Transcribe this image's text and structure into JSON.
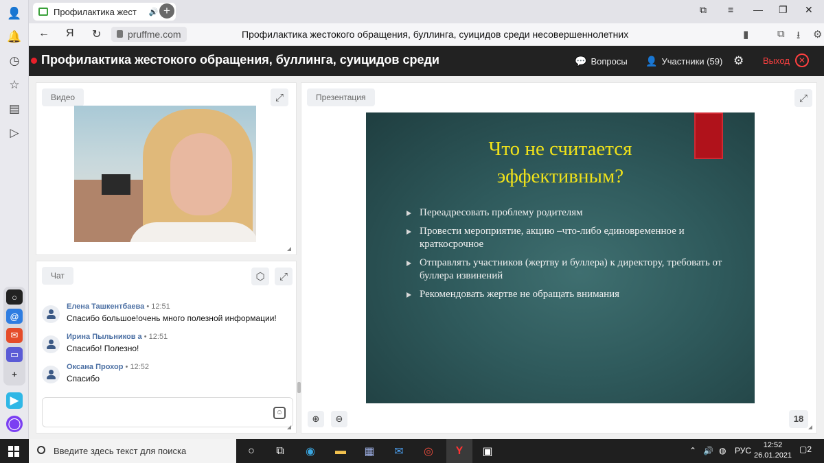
{
  "browser": {
    "tab_title": "Профилактика жест",
    "url": "pruffme.com",
    "page_title": "Профилактика жестокого обращения, буллинга, суицидов среди несовершеннолетних"
  },
  "webinar": {
    "title": "Профилактика жестокого обращения, буллинга, суицидов среди",
    "questions_label": "Вопросы",
    "participants_label": "Участники (59)",
    "exit_label": "Выход"
  },
  "video_panel": {
    "label": "Видео"
  },
  "chat": {
    "label": "Чат",
    "messages": [
      {
        "name": "Елена Ташкентбаева",
        "time": "• 12:51",
        "text": "Спасибо большое!очень много полезной информации!"
      },
      {
        "name": "Ирина Пыльников а",
        "time": "• 12:51",
        "text": "Спасибо! Полезно!"
      },
      {
        "name": "Оксана Прохор",
        "time": "• 12:52",
        "text": "Спасибо"
      }
    ],
    "input_value": ""
  },
  "presentation": {
    "label": "Презентация",
    "slide_title_line1": "Что не считается",
    "slide_title_line2": "эффективным?",
    "bullets": [
      "Переадресовать проблему родителям",
      "Провести мероприятие, акцию –что-либо единовременное и краткосрочное",
      "Отправлять участников (жертву и буллера) к директору, требовать от буллера извинений",
      "Рекомендовать жертве не обращать внимания"
    ],
    "page_number": "18"
  },
  "taskbar": {
    "search_placeholder": "Введите здесь текст для поиска",
    "language": "РУС",
    "time": "12:52",
    "date": "26.01.2021",
    "notifications": "2"
  },
  "colors": {
    "header_bg": "#222222",
    "exit_red": "#ff4040",
    "slide_title": "#f0e21a",
    "name_blue": "#4b6fa3"
  }
}
